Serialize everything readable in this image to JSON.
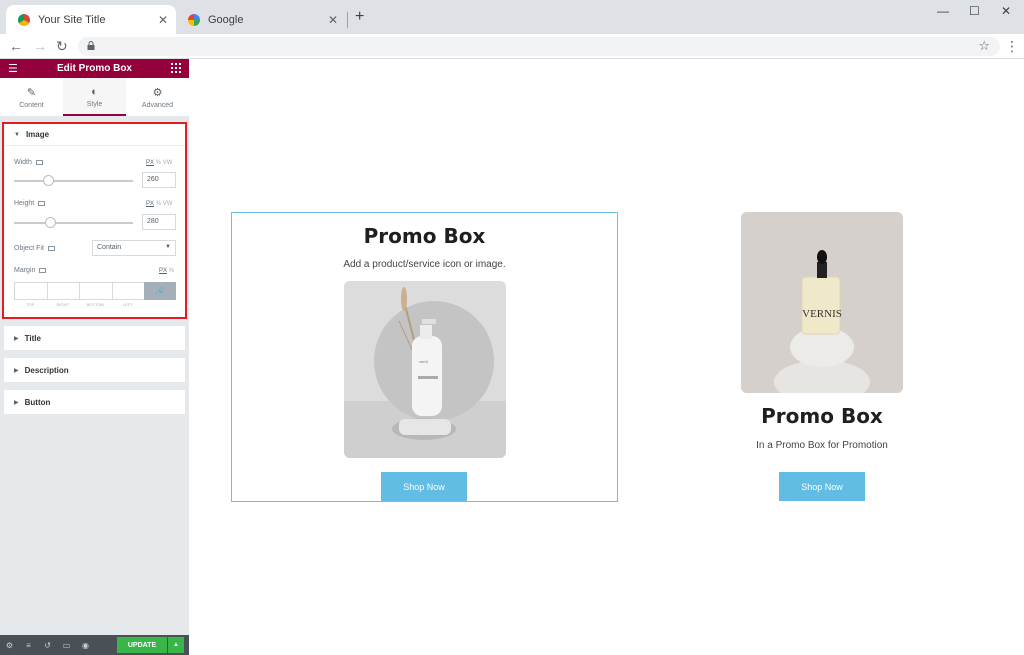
{
  "browser": {
    "tabs": [
      {
        "title": "Your Site Title",
        "favicon": "chrome-icon"
      },
      {
        "title": "Google",
        "favicon": "google-g-icon"
      }
    ]
  },
  "panel": {
    "header_title": "Edit Promo Box",
    "tabs": [
      {
        "label": "Content",
        "icon": "pencil-icon"
      },
      {
        "label": "Style",
        "icon": "contrast-icon"
      },
      {
        "label": "Advanced",
        "icon": "gear-icon"
      }
    ],
    "image_section": {
      "title": "Image",
      "width": {
        "label": "Width",
        "units": [
          "PX",
          "%",
          "VW"
        ],
        "value": "260",
        "level": 0.27
      },
      "height": {
        "label": "Height",
        "units": [
          "PX",
          "%",
          "VW"
        ],
        "value": "280",
        "level": 0.29
      },
      "object_fit": {
        "label": "Object Fit",
        "value": "Contain"
      },
      "margin": {
        "label": "Margin",
        "units": [
          "PX",
          "%"
        ],
        "sides": [
          "TOP",
          "RIGHT",
          "BOTTOM",
          "LEFT"
        ]
      }
    },
    "collapsed_sections": [
      "Title",
      "Description",
      "Button"
    ],
    "footer": {
      "update_label": "UPDATE"
    }
  },
  "preview": {
    "promo_left": {
      "title": "Promo Box",
      "description": "Add a product/service icon or image.",
      "button": "Shop Now",
      "bottle_label": "verdi"
    },
    "promo_right": {
      "title": "Promo Box",
      "description": "In a Promo Box for Promotion",
      "button": "Shop Now",
      "bottle_label": "VERNIS"
    }
  },
  "colors": {
    "panel_header": "#93003c",
    "highlight_outline": "#e31b23",
    "button": "#61bde4",
    "update": "#39b54a"
  }
}
